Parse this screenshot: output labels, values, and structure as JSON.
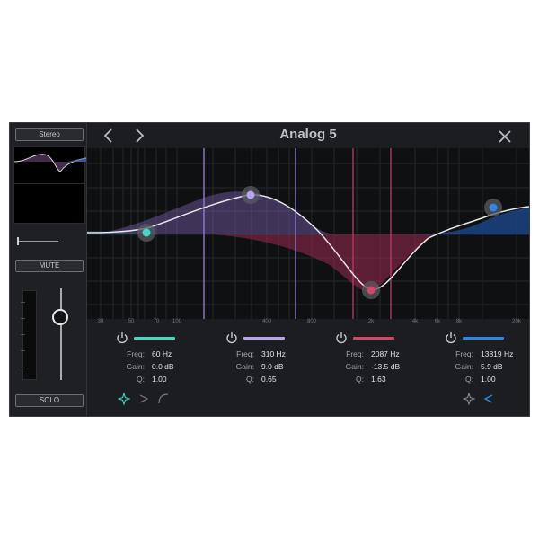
{
  "app": {
    "title": "Analog 5"
  },
  "left_strip": {
    "stereo_label": "Stereo",
    "mute_label": "MUTE",
    "solo_label": "SOLO"
  },
  "graph": {
    "freq_axis_labels": [
      "30",
      "50",
      "70",
      "100",
      "400",
      "800",
      "2k",
      "4k",
      "6k",
      "8k",
      "20k"
    ]
  },
  "bands": [
    {
      "color": "#3fd9c4",
      "freq_label": "Freq:",
      "freq": "60 Hz",
      "gain_label": "Gain:",
      "gain": "0.0 dB",
      "q_label": "Q:",
      "q": "1.00"
    },
    {
      "color": "#b9a3f0",
      "freq_label": "Freq:",
      "freq": "310 Hz",
      "gain_label": "Gain:",
      "gain": "9.0 dB",
      "q_label": "Q:",
      "q": "0.65"
    },
    {
      "color": "#d6456a",
      "freq_label": "Freq:",
      "freq": "2087 Hz",
      "gain_label": "Gain:",
      "gain": "-13.5 dB",
      "q_label": "Q:",
      "q": "1.63"
    },
    {
      "color": "#2f86e6",
      "freq_label": "Freq:",
      "freq": "13819 Hz",
      "gain_label": "Gain:",
      "gain": "5.9 dB",
      "q_label": "Q:",
      "q": "1.00"
    }
  ],
  "icons": {
    "nav_back": "chevron-left-icon",
    "nav_forward": "chevron-right-icon",
    "close": "close-icon",
    "power": "power-icon",
    "low_shelf_shape": "sparkle-icon",
    "low_cut_shape": "chevron-right-icon",
    "high_shape": "curve-icon",
    "high_shelf_shape": "sparkle-icon",
    "high_cut_shape": "chevron-left-icon"
  }
}
